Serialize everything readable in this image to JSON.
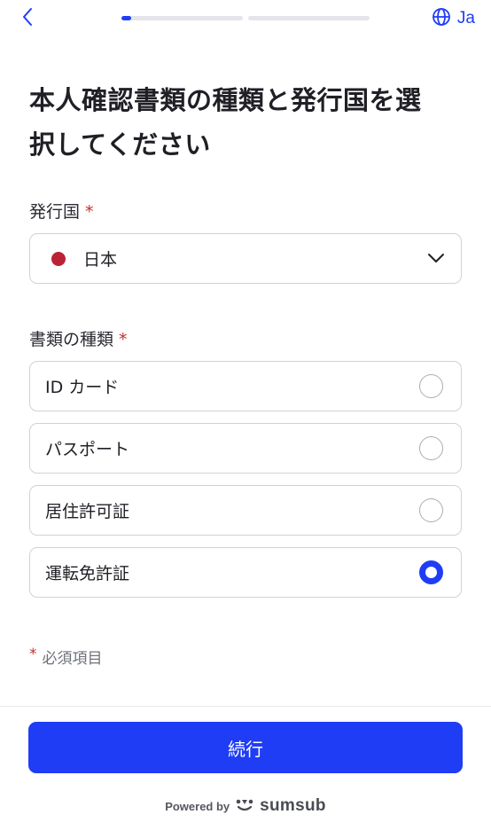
{
  "header": {
    "back_icon": "chevron-left-icon",
    "language_icon": "globe-icon",
    "language_label": "Ja",
    "progress_steps": 2,
    "progress_current_fraction": 0.08,
    "accent_color": "#1f3df5"
  },
  "title": {
    "line1": "本人確認書類の種類と発行国を選",
    "line2": "択してください"
  },
  "country": {
    "label": "発行国",
    "required_mark": "*",
    "selected": "日本",
    "flag_color": "#bc2236",
    "dropdown_icon": "chevron-down-icon"
  },
  "document_type": {
    "label": "書類の種類",
    "required_mark": "*",
    "options": [
      {
        "label": "ID カード",
        "selected": false
      },
      {
        "label": "パスポート",
        "selected": false
      },
      {
        "label": "居住許可証",
        "selected": false
      },
      {
        "label": "運転免許証",
        "selected": true
      }
    ]
  },
  "note": {
    "mark": "*",
    "text": "必須項目"
  },
  "footer": {
    "continue_label": "続行",
    "powered_by": "Powered by",
    "brand": "sumsub"
  }
}
